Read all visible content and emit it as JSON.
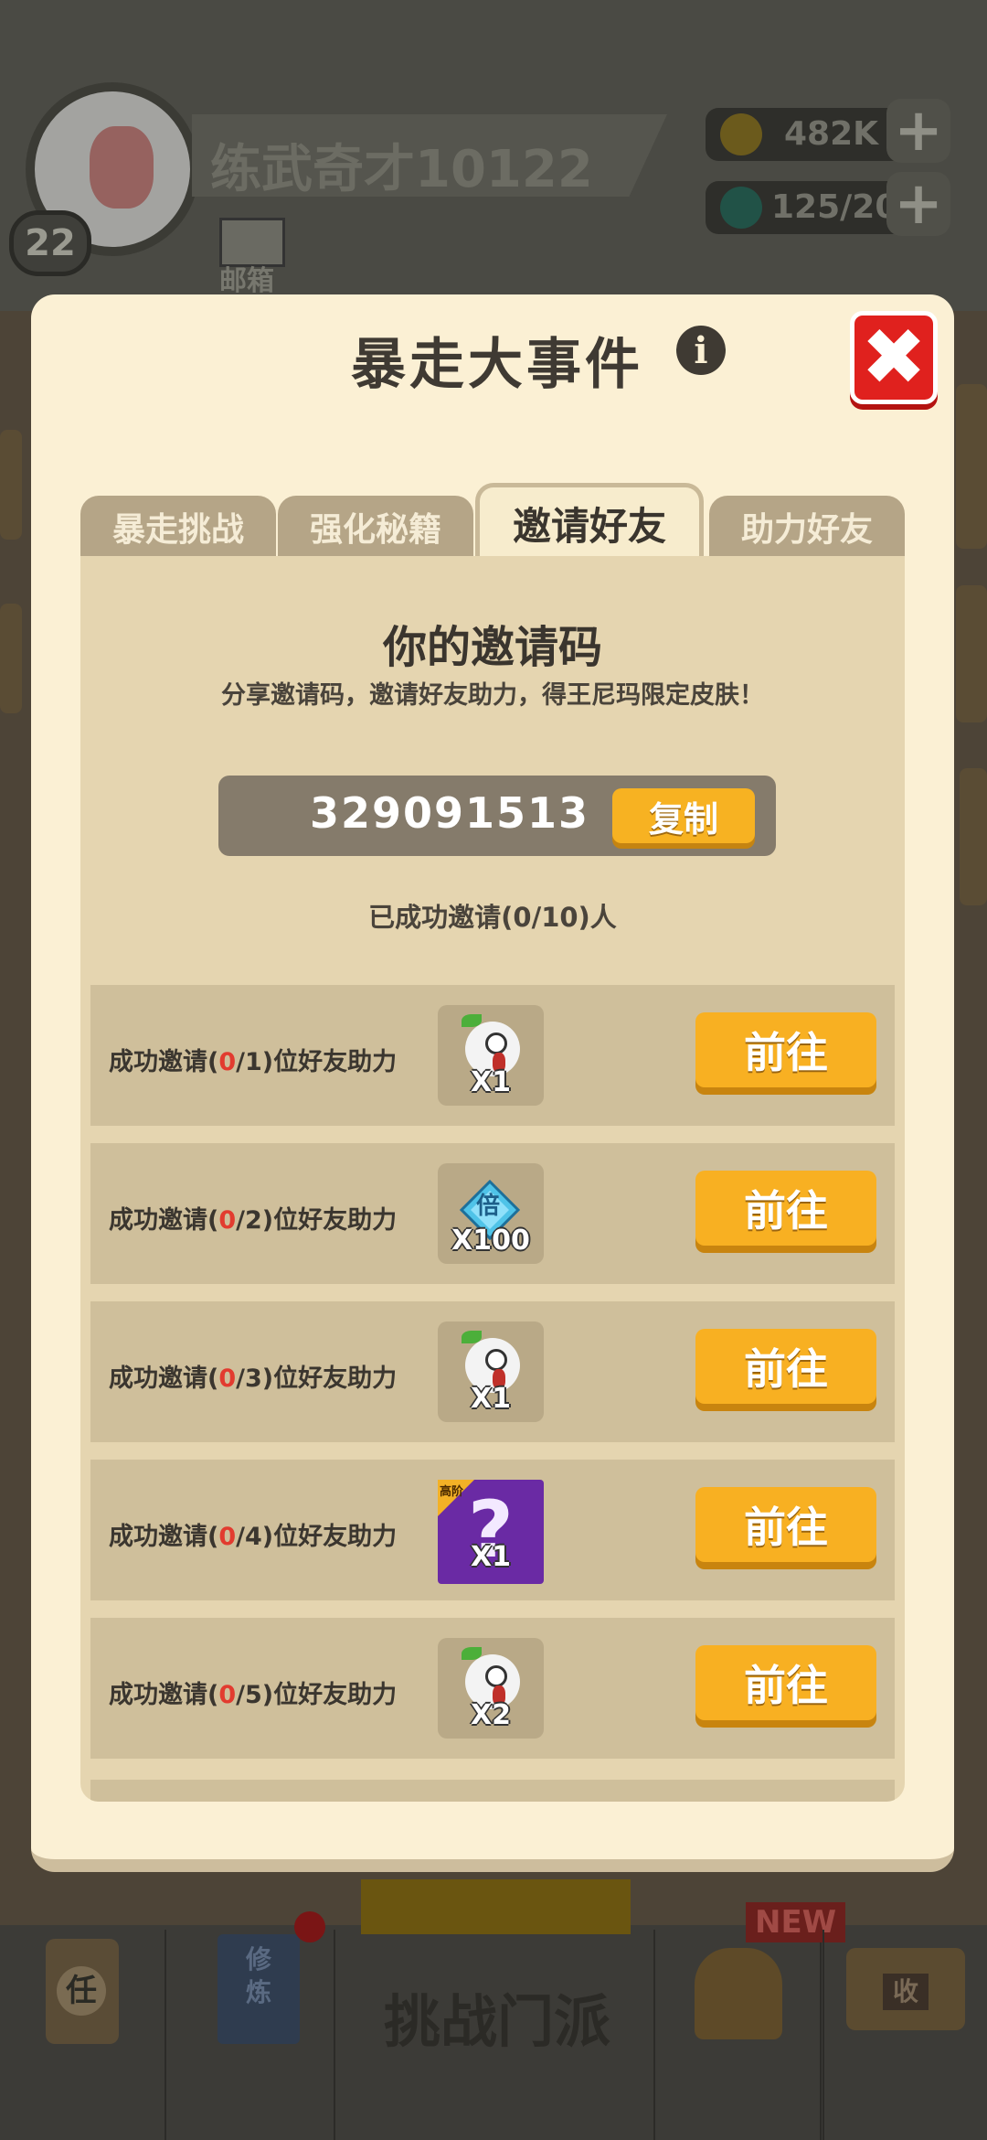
{
  "background": {
    "player_name": "练武奇才10122",
    "level": "22",
    "mail_label": "邮箱",
    "gold": "482K",
    "energy": "125/20",
    "plus": "+"
  },
  "bottom_nav": {
    "task_label": "任",
    "cultivate_label": "修\n炼",
    "center_label": "挑战门派",
    "new_badge": "NEW",
    "collect_label": "收"
  },
  "modal": {
    "title": "暴走大事件",
    "info_symbol": "i",
    "close_symbol": "✖",
    "tabs": [
      {
        "label": "暴走挑战",
        "active": false
      },
      {
        "label": "强化秘籍",
        "active": false
      },
      {
        "label": "邀请好友",
        "active": true
      },
      {
        "label": "助力好友",
        "active": false
      }
    ],
    "invite": {
      "heading": "你的邀请码",
      "subtitle": "分享邀请码，邀请好友助力，得王尼玛限定皮肤！",
      "code": "329091513",
      "copy_label": "复制",
      "invited_count": "已成功邀请(0/10)人"
    },
    "rows": [
      {
        "prefix": "成功邀请(",
        "done": "0",
        "goal": "/1)位好友助力",
        "reward": "character",
        "qty": "X1",
        "button": "前往"
      },
      {
        "prefix": "成功邀请(",
        "done": "0",
        "goal": "/2)位好友助力",
        "reward": "gem",
        "gem_char": "倍",
        "qty": "X100",
        "button": "前往"
      },
      {
        "prefix": "成功邀请(",
        "done": "0",
        "goal": "/3)位好友助力",
        "reward": "character",
        "qty": "X1",
        "button": "前往"
      },
      {
        "prefix": "成功邀请(",
        "done": "0",
        "goal": "/4)位好友助力",
        "reward": "mystery-box",
        "tag": "高阶",
        "qty": "X1",
        "button": "前往"
      },
      {
        "prefix": "成功邀请(",
        "done": "0",
        "goal": "/5)位好友助力",
        "reward": "character",
        "qty": "X2",
        "button": "前往"
      }
    ]
  },
  "colors": {
    "modal_bg": "#fbf0d4",
    "panel_bg": "#e5d5b0",
    "row_bg": "#cfbf9b",
    "button_orange": "#f8b022",
    "close_red": "#e0211e",
    "highlight_red": "#e23b2f"
  }
}
